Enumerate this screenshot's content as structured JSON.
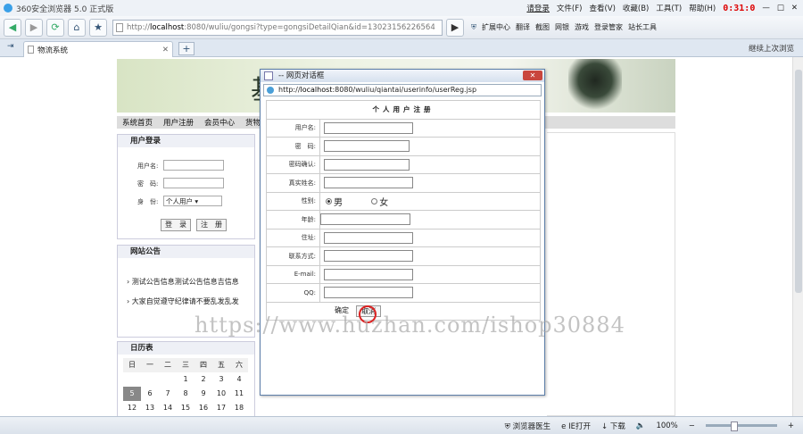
{
  "browser": {
    "title": "360安全浏览器 5.0 正式版",
    "login": "请登录",
    "menus": [
      "文件(F)",
      "查看(V)",
      "收藏(B)",
      "工具(T)",
      "帮助(H)"
    ],
    "clock": "0:31:0",
    "address_prefix": "http://",
    "address_host": "localhost",
    "address_rest": ":8080/wuliu/gongsi?type=gongsiDetailQian&id=13023156226564",
    "toolbar": [
      "扩展中心",
      "翻译",
      "截图",
      "网银",
      "游戏",
      "登录管家",
      "站长工具"
    ],
    "tab_title": "物流系统",
    "restore_label": "继续上次浏览",
    "status": [
      "浏览器医生",
      "IE打开",
      "下载",
      "100%"
    ]
  },
  "site": {
    "banner_char": "基",
    "nav": [
      "系统首页",
      "用户注册",
      "会员中心",
      "货物信息"
    ],
    "login_box": {
      "title": "用户登录",
      "user_label": "用户名:",
      "pass_label": "密　码:",
      "role_label": "身　份:",
      "role_value": "个人用户",
      "login_btn": "登　录",
      "reg_btn": "注　册"
    },
    "notice": {
      "title": "网站公告",
      "items": [
        "测试公告信息测试公告信息吉信息",
        "大家自觉遵守纪律请不要乱发乱发"
      ]
    },
    "calendar": {
      "title": "日历表",
      "weekdays": [
        "日",
        "一",
        "二",
        "三",
        "四",
        "五",
        "六"
      ],
      "rows": [
        [
          "",
          "",
          "",
          "1",
          "2",
          "3",
          "4"
        ],
        [
          "5",
          "6",
          "7",
          "8",
          "9",
          "10",
          "11"
        ],
        [
          "12",
          "13",
          "14",
          "15",
          "16",
          "17",
          "18"
        ]
      ]
    }
  },
  "dialog": {
    "title": "-- 网页对话框",
    "url_prefix": "http://",
    "url_host": "localhost",
    "url_rest": ":8080/wuliu/qiantai/userinfo/userReg.jsp",
    "heading": "个人用户注册",
    "fields": [
      "用户名:",
      "密　码:",
      "密码确认:",
      "真实姓名:",
      "性别:",
      "年龄:",
      "住址:",
      "联系方式:",
      "E-mail:",
      "QQ:"
    ],
    "gender_male": "男",
    "gender_female": "女",
    "ok": "确定",
    "cancel": "取消"
  },
  "watermark": "https://www.huzhan.com/ishop30884"
}
